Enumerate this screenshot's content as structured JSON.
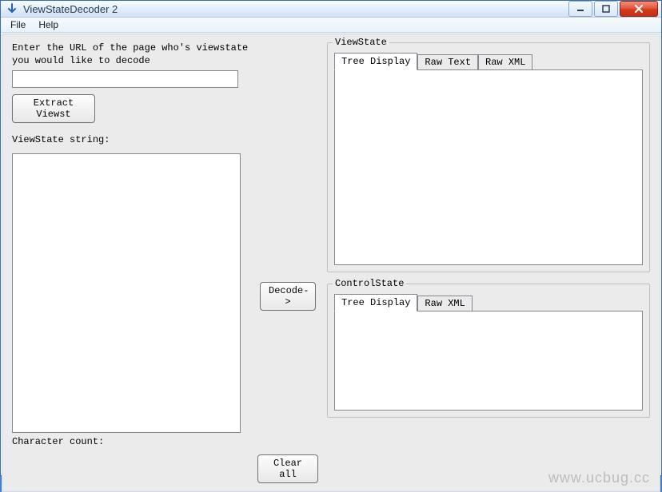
{
  "window": {
    "title": "ViewStateDecoder 2"
  },
  "menu": {
    "file": "File",
    "help": "Help"
  },
  "left": {
    "url_label": "Enter the URL of the page who's viewstate you would like to decode",
    "url_value": "",
    "extract_button": "Extract Viewst",
    "viewstate_label": "ViewState string:",
    "viewstate_value": "",
    "charcount_label": "Character count:"
  },
  "middle": {
    "decode_button": "Decode->",
    "clear_button": "Clear all"
  },
  "right": {
    "viewstate": {
      "group_label": "ViewState",
      "tabs": {
        "tree": "Tree Display",
        "rawtext": "Raw Text",
        "rawxml": "Raw XML"
      }
    },
    "controlstate": {
      "group_label": "ControlState",
      "tabs": {
        "tree": "Tree Display",
        "rawxml": "Raw XML"
      }
    }
  },
  "watermark": "www.ucbug.cc"
}
